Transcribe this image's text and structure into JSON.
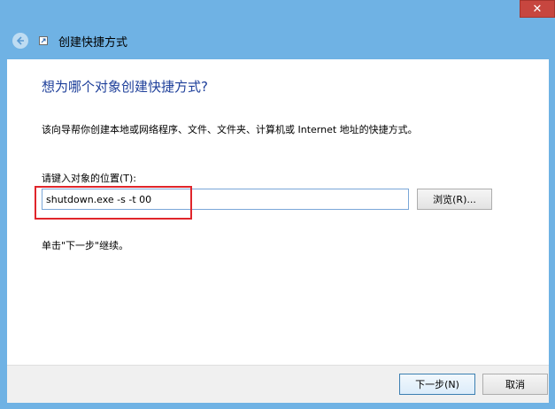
{
  "window": {
    "title": "创建快捷方式",
    "close_label": "✕"
  },
  "content": {
    "heading": "想为哪个对象创建快捷方式?",
    "description": "该向导帮你创建本地或网络程序、文件、文件夹、计算机或 Internet 地址的快捷方式。",
    "location_label": "请键入对象的位置(T):",
    "location_value": "shutdown.exe -s -t 00",
    "browse_label": "浏览(R)...",
    "instruction": "单击\"下一步\"继续。"
  },
  "footer": {
    "next_label": "下一步(N)",
    "cancel_label": "取消"
  },
  "colors": {
    "title_bar": "#6fb2e4",
    "heading": "#1e3f9a",
    "highlight": "#e0252b",
    "close_button": "#c7463f"
  },
  "icons": [
    "back-arrow-icon",
    "shortcut-app-icon",
    "close-icon"
  ]
}
